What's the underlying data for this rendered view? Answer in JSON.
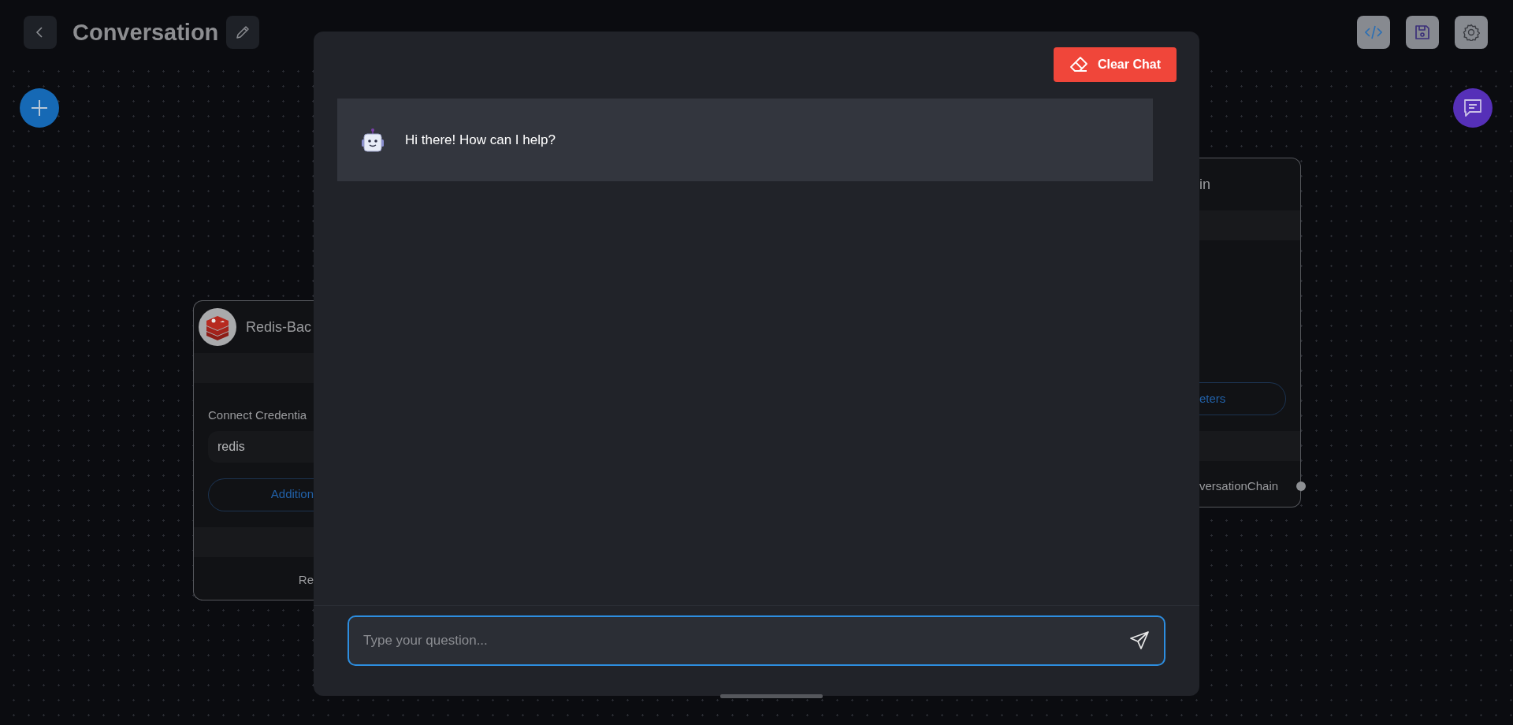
{
  "header": {
    "title": "Conversation",
    "actions": [
      {
        "kind": "code"
      },
      {
        "kind": "save"
      },
      {
        "kind": "settings"
      }
    ]
  },
  "nodes": [
    {
      "title": "Redis-Bac",
      "kind": "redis",
      "rows": [
        {
          "kind": "band"
        },
        {
          "kind": "label",
          "text": "Connect Credentia"
        },
        {
          "kind": "field",
          "text": "redis"
        },
        {
          "kind": "button",
          "text": "Addition"
        },
        {
          "kind": "band"
        },
        {
          "kind": "output",
          "text": "Re"
        }
      ]
    },
    {
      "title": "in",
      "rows": [
        {
          "kind": "band"
        },
        {
          "kind": "space"
        },
        {
          "kind": "button",
          "text": "eters"
        },
        {
          "kind": "band"
        },
        {
          "kind": "output",
          "text": "versationChain",
          "handle": true
        }
      ]
    }
  ],
  "chat": {
    "clear_button": "Clear Chat",
    "messages": [
      {
        "kind": "bot",
        "text": "Hi there! How can I help?"
      }
    ],
    "input": {
      "placeholder": "Type your question...",
      "focused": true
    }
  }
}
